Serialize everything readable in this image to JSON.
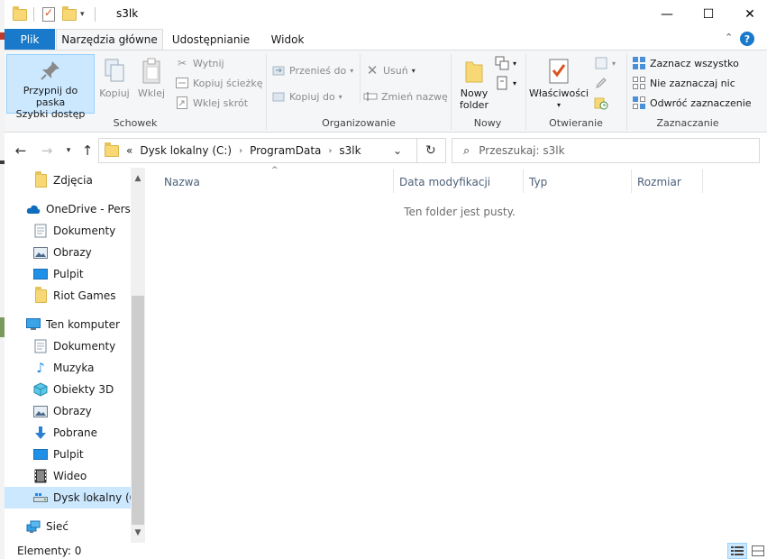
{
  "window": {
    "title": "s3lk",
    "minimize_glyph": "—",
    "maximize_glyph": "☐",
    "close_glyph": "✕"
  },
  "tabs": {
    "file": "Plik",
    "home": "Narzędzia główne",
    "share": "Udostępnianie",
    "view": "Widok",
    "help_glyph": "?"
  },
  "ribbon": {
    "clipboard": {
      "pin_line1": "Przypnij do paska",
      "pin_line2": "Szybki dostęp",
      "copy": "Kopiuj",
      "paste": "Wklej",
      "cut": "Wytnij",
      "copy_path": "Kopiuj ścieżkę",
      "paste_shortcut": "Wklej skrót",
      "label": "Schowek"
    },
    "organize": {
      "move_to": "Przenieś do",
      "copy_to": "Kopiuj do",
      "delete": "Usuń",
      "rename": "Zmień nazwę",
      "label": "Organizowanie"
    },
    "new": {
      "new_folder_line1": "Nowy",
      "new_folder_line2": "folder",
      "label": "Nowy"
    },
    "open": {
      "properties": "Właściwości",
      "label": "Otwieranie"
    },
    "select": {
      "select_all": "Zaznacz wszystko",
      "select_none": "Nie zaznaczaj nic",
      "invert": "Odwróć zaznaczenie",
      "label": "Zaznaczanie"
    }
  },
  "address": {
    "prefix": "«",
    "crumbs": [
      "Dysk lokalny (C:)",
      "ProgramData",
      "s3lk"
    ],
    "search_placeholder": "Przeszukaj: s3lk"
  },
  "navpane": {
    "items": [
      {
        "label": "Zdjęcia",
        "icon": "folder-icon"
      },
      {
        "label": "OneDrive - Persor",
        "icon": "cloud-icon"
      },
      {
        "label": "Dokumenty",
        "icon": "documents-icon"
      },
      {
        "label": "Obrazy",
        "icon": "pictures-icon"
      },
      {
        "label": "Pulpit",
        "icon": "desktop-icon"
      },
      {
        "label": "Riot Games",
        "icon": "folder-icon"
      },
      {
        "label": "Ten komputer",
        "icon": "computer-icon"
      },
      {
        "label": "Dokumenty",
        "icon": "documents-icon"
      },
      {
        "label": "Muzyka",
        "icon": "music-icon"
      },
      {
        "label": "Obiekty 3D",
        "icon": "objects3d-icon"
      },
      {
        "label": "Obrazy",
        "icon": "pictures-icon"
      },
      {
        "label": "Pobrane",
        "icon": "download-icon"
      },
      {
        "label": "Pulpit",
        "icon": "desktop-icon"
      },
      {
        "label": "Wideo",
        "icon": "video-icon"
      },
      {
        "label": "Dysk lokalny (C:)",
        "icon": "drive-icon"
      },
      {
        "label": "Sieć",
        "icon": "network-icon"
      }
    ]
  },
  "content": {
    "columns": [
      "Nazwa",
      "Data modyfikacji",
      "Typ",
      "Rozmiar"
    ],
    "empty_message": "Ten folder jest pusty."
  },
  "status": {
    "items_count": "Elementy: 0"
  },
  "colors": {
    "accent": "#1979ca",
    "selection": "#cce8ff",
    "folder": "#f8d775"
  }
}
